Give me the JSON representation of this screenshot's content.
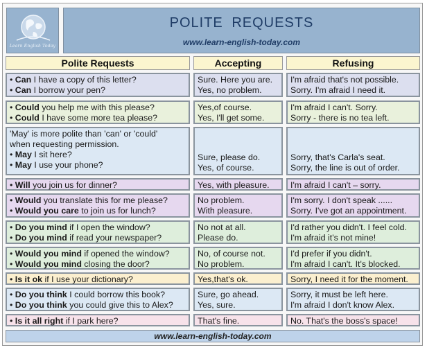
{
  "header": {
    "logo_text": "Learn English Today",
    "title": "POLITE  REQUESTS",
    "url": "www.learn-english-today.com"
  },
  "columns": [
    "Polite Requests",
    "Accepting",
    "Refusing"
  ],
  "rows": [
    {
      "color": "#dcdfef",
      "requests": [
        {
          "bold": "Can",
          "rest": " I have a copy of this letter?"
        },
        {
          "bold": "Can",
          "rest": " I borrow your pen?"
        }
      ],
      "accepting": [
        "Sure.  Here you are.",
        "Yes, no problem."
      ],
      "refusing": [
        "I'm afraid that's not possible.",
        "Sorry. I'm afraid I need it."
      ]
    },
    {
      "color": "#e9f1dc",
      "requests": [
        {
          "bold": "Could",
          "rest": " you help me with this please?"
        },
        {
          "bold": "Could",
          "rest": " I have some more tea please?"
        }
      ],
      "accepting": [
        "Yes,of course.",
        "Yes, I'll get some."
      ],
      "refusing": [
        "I'm afraid I can't.  Sorry.",
        "Sorry -  there is no tea left."
      ]
    },
    {
      "color": "#dce8f4",
      "note": [
        "'May' is more polite than 'can' or 'could'",
        " when requesting permission."
      ],
      "requests": [
        {
          "bold": "May",
          "rest": " I sit here?"
        },
        {
          "bold": "May",
          "rest": " I use your phone?"
        }
      ],
      "accepting": [
        "Sure,  please do.",
        "Yes, of course."
      ],
      "refusing": [
        "Sorry, that's Carla's seat.",
        "Sorry, the line is out of order."
      ]
    },
    {
      "color": "#e6d8ef",
      "requests": [
        {
          "bold": "Will",
          "rest": " you join us for dinner?"
        }
      ],
      "accepting": [
        "Yes, with pleasure."
      ],
      "refusing": [
        "I'm afraid I can't – sorry."
      ]
    },
    {
      "color": "#e6d8ef",
      "requests": [
        {
          "bold": "Would",
          "rest": " you translate this for me please?"
        },
        {
          "bold": "Would you care",
          "rest": " to join us for lunch?"
        }
      ],
      "accepting": [
        "No problem.",
        "With pleasure."
      ],
      "refusing": [
        "I'm sorry.  I don't speak ......",
        "Sorry. I've got an appointment."
      ]
    },
    {
      "color": "#deeedc",
      "requests": [
        {
          "bold": "Do you mind",
          "rest": " if I open the window?"
        },
        {
          "bold": "Do you mind",
          "rest": " if read your newspaper?"
        }
      ],
      "accepting": [
        "No not at all.",
        "Please do."
      ],
      "refusing": [
        "I'd rather you didn't. I feel cold.",
        "I'm afraid it's not mine!"
      ]
    },
    {
      "color": "#deeedc",
      "requests": [
        {
          "bold": "Would you mind",
          "rest": " if opened the window?"
        },
        {
          "bold": "Would you mind",
          "rest": " closing the door?"
        }
      ],
      "accepting": [
        "No, of course not.",
        "No problem."
      ],
      "refusing": [
        "I'd prefer if you didn't.",
        "I'm afraid I can't.  It's blocked."
      ]
    },
    {
      "color": "#fbefcf",
      "requests": [
        {
          "bold": "Is it ok",
          "rest": " if I use your dictionary?"
        }
      ],
      "accepting": [
        "Yes,that's ok."
      ],
      "refusing": [
        "Sorry, I need it for the moment."
      ]
    },
    {
      "color": "#dce8f4",
      "requests": [
        {
          "bold": "Do you think",
          "rest": " I could borrow this book?"
        },
        {
          "bold": "Do you think",
          "rest": " you could give this to Alex?"
        }
      ],
      "accepting": [
        "Sure,  go ahead.",
        "Yes, sure."
      ],
      "refusing": [
        "Sorry, it must be left here.",
        "I'm afraid I don't know Alex."
      ]
    },
    {
      "color": "#f7e2ea",
      "requests": [
        {
          "bold": "Is it all right",
          "rest": " if I park here?"
        }
      ],
      "accepting": [
        "That's fine."
      ],
      "refusing": [
        "No. That's the boss's space!"
      ]
    }
  ],
  "footer": {
    "url": "www.learn-english-today.com"
  }
}
